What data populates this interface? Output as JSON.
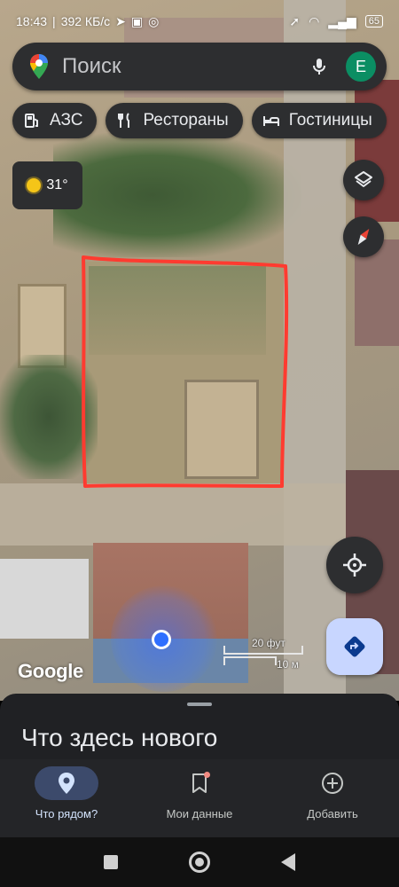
{
  "status_bar": {
    "time": "18:43",
    "speed": "392 КБ/с",
    "battery": "65"
  },
  "search": {
    "placeholder": "Поиск",
    "avatar_letter": "E"
  },
  "chips": [
    {
      "label": "АЗС",
      "icon": "gas-station-icon"
    },
    {
      "label": "Рестораны",
      "icon": "restaurant-icon"
    },
    {
      "label": "Гостиницы",
      "icon": "hotel-icon"
    }
  ],
  "weather": {
    "temperature": "31°",
    "icon": "sun-icon"
  },
  "map": {
    "scale_feet": "20 фут",
    "scale_meters": "10 м",
    "attribution": "Google",
    "outline_color": "#ff3b30"
  },
  "sheet": {
    "title": "Что здесь нового"
  },
  "bottom_nav": [
    {
      "label": "Что рядом?",
      "icon": "explore-pin-icon",
      "active": true
    },
    {
      "label": "Мои данные",
      "icon": "bookmark-icon",
      "active": false
    },
    {
      "label": "Добавить",
      "icon": "add-circle-icon",
      "active": false
    }
  ],
  "colors": {
    "accent": "#c8d6ff",
    "avatar": "#0b8e63",
    "location_dot": "#2f6fff"
  }
}
